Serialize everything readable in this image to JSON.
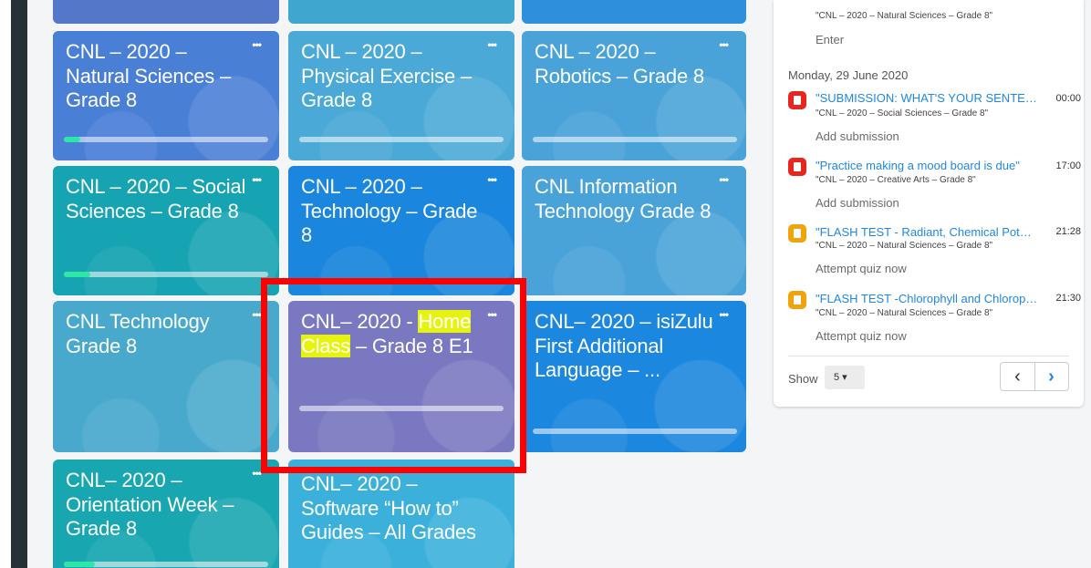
{
  "courses": [
    {
      "title_parts": [
        "CNL – 2020 – Natural Sciences – Grade 8"
      ],
      "menu": "•••",
      "progress": 0.08,
      "color": "#4a7fd6"
    },
    {
      "title_parts": [
        "CNL – 2020 – Physical Exercise – Grade 8"
      ],
      "menu": "•••",
      "progress": 0.0,
      "color": "#4aa9d6"
    },
    {
      "title_parts": [
        "CNL – 2020 – Robotics – Grade 8"
      ],
      "menu": "•••",
      "progress": 0.0,
      "color": "#4aa3d8"
    },
    {
      "title_parts": [
        "CNL – 2020 – Social Sciences – Grade 8"
      ],
      "menu": "•••",
      "progress": 0.13,
      "color": "#16a3b2"
    },
    {
      "title_parts": [
        "CNL – 2020 – Technology – Grade 8"
      ],
      "menu": "•••",
      "progress": 0.0,
      "color": "#1a86dd"
    },
    {
      "title_parts": [
        "CNL Information Technology Grade 8"
      ],
      "menu": "•••",
      "progress": 0.0,
      "color": "#4aa3d8"
    },
    {
      "title_parts": [
        "CNL Technology Grade 8"
      ],
      "menu": "•••",
      "progress": 0.0,
      "color": "#49a9cc"
    },
    {
      "title_parts": [
        "CNL– 2020 - ",
        "Home Class",
        " – Grade 8 E1"
      ],
      "menu": "•••",
      "progress": 0.0,
      "color": "#7a78c0"
    },
    {
      "title_parts": [
        "CNL– 2020 – isiZulu First Additional Language – ..."
      ],
      "menu": "•••",
      "progress": 0.0,
      "color": "#1c87de"
    },
    {
      "title_parts": [
        "CNL– 2020 – Orientation Week – Grade 8"
      ],
      "menu": "•••",
      "progress": 0.15,
      "color": "#18a6b0"
    },
    {
      "title_parts": [
        "CNL– 2020 – Software “How to” Guides – All Grades"
      ],
      "menu": "•••",
      "progress": 0.0,
      "color": "#3ab0db"
    }
  ],
  "timeline": {
    "top_course": "\"CNL – 2020 – Natural Sciences – Grade 8\"",
    "top_action": "Enter",
    "date": "Monday, 29 June 2020",
    "events": [
      {
        "title": "\"SUBMISSION: WHAT'S YOUR SENTENCE?\"",
        "time": "00:00",
        "course": "\"CNL – 2020 – Social Sciences – Grade 8\"",
        "action": "Add submission",
        "icon": "assignment-icon",
        "icon_color": "#e6261f"
      },
      {
        "title": "\"Practice making a mood board is due\"",
        "time": "17:00",
        "course": "\"CNL – 2020 – Creative Arts – Grade 8\"",
        "action": "Add submission",
        "icon": "assignment-icon",
        "icon_color": "#e6261f"
      },
      {
        "title": "\"FLASH TEST - Radiant, Chemical Potential\"",
        "time": "21:28",
        "course": "\"CNL – 2020 – Natural Sciences – Grade 8\"",
        "action": "Attempt quiz now",
        "icon": "quiz-icon",
        "icon_color": "#f0a30a"
      },
      {
        "title": "\"FLASH TEST -Chlorophyll and Chloroplasts\"",
        "time": "21:30",
        "course": "\"CNL – 2020 – Natural Sciences – Grade 8\"",
        "action": "Attempt quiz now",
        "icon": "quiz-icon",
        "icon_color": "#f0a30a"
      }
    ],
    "show_label": "Show",
    "show_value": "5 ▾",
    "prev": "‹",
    "next": "›"
  }
}
